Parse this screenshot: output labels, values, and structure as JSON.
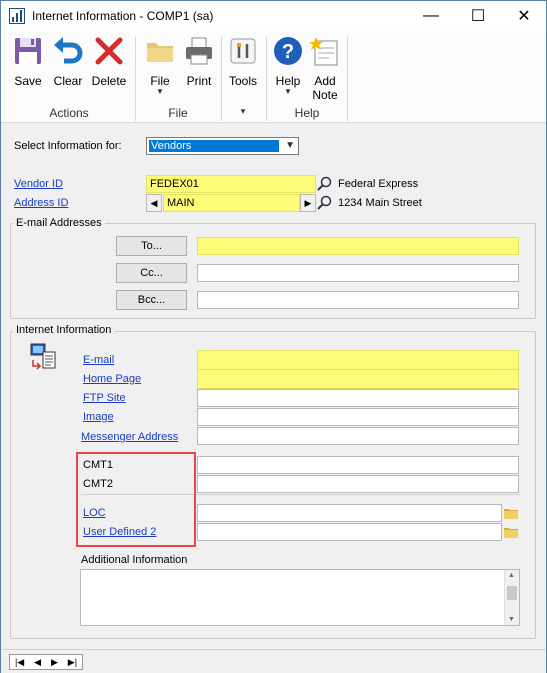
{
  "window": {
    "title": "Internet Information  -  COMP1 (sa)",
    "minimize": "—",
    "maximize": "☐",
    "close": "✕"
  },
  "ribbon": {
    "buttons": {
      "save": "Save",
      "clear": "Clear",
      "delete": "Delete",
      "file": "File",
      "print": "Print",
      "tools": "Tools",
      "help": "Help",
      "add_note_line1": "Add",
      "add_note_line2": "Note"
    },
    "groups": {
      "actions": "Actions",
      "file": "File",
      "tools": "▾",
      "help": "Help"
    }
  },
  "form": {
    "select_info_label": "Select Information for:",
    "select_info_value": "Vendors",
    "vendor_id_label": "Vendor ID",
    "vendor_id_value": "FEDEX01",
    "vendor_name": "Federal Express",
    "address_id_label": "Address ID",
    "address_id_value": "MAIN",
    "address_line": "1234 Main Street",
    "email_group_title": "E-mail Addresses",
    "to_button": "To...",
    "cc_button": "Cc...",
    "bcc_button": "Bcc...",
    "to_value": "",
    "cc_value": "",
    "bcc_value": "",
    "internet_group_title": "Internet Information",
    "email_label": "E-mail",
    "homepage_label": "Home Page",
    "ftp_label": "FTP Site",
    "image_label": "Image",
    "messenger_label": "Messenger Address",
    "cmt1_label": "CMT1",
    "cmt2_label": "CMT2",
    "loc_label": "LOC",
    "user_defined_2_label": "User Defined 2",
    "additional_info_label": "Additional Information"
  },
  "nav": {
    "first": "|◀",
    "prev": "◀",
    "next": "▶",
    "last": "▶|"
  },
  "colors": {
    "required_yellow": "#fdfb78",
    "highlight_red": "#e54848",
    "link_blue": "#1a3cc2"
  }
}
